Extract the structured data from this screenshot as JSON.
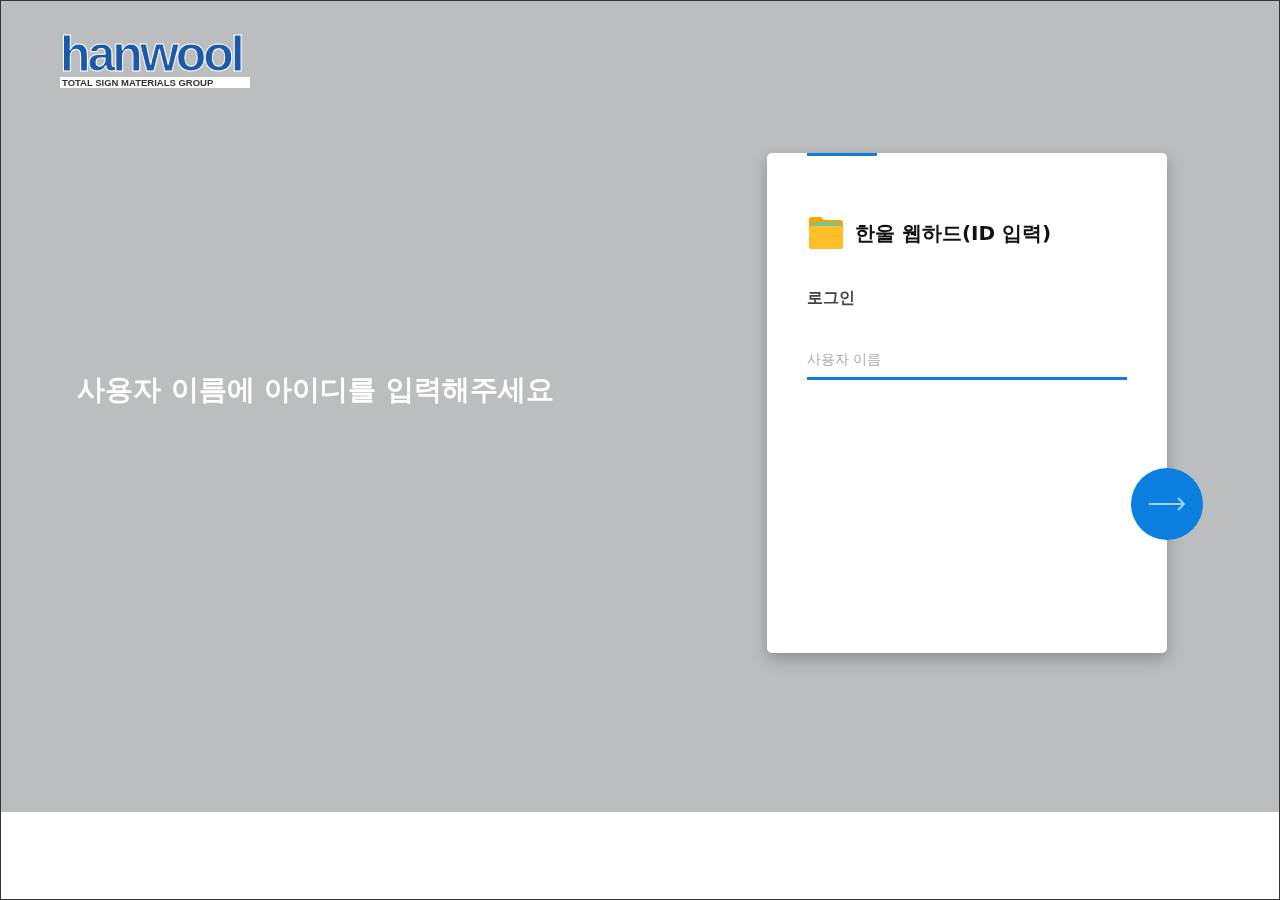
{
  "logo": {
    "wordmark": "hanwool",
    "tagline": "TOTAL SIGN MATERIALS GROUP"
  },
  "hint": "사용자 이름에 아이디를 입력해주세요",
  "card": {
    "title": "한울 웹하드(ID 입력)",
    "section": "로그인",
    "username": {
      "placeholder": "사용자 이름"
    }
  }
}
